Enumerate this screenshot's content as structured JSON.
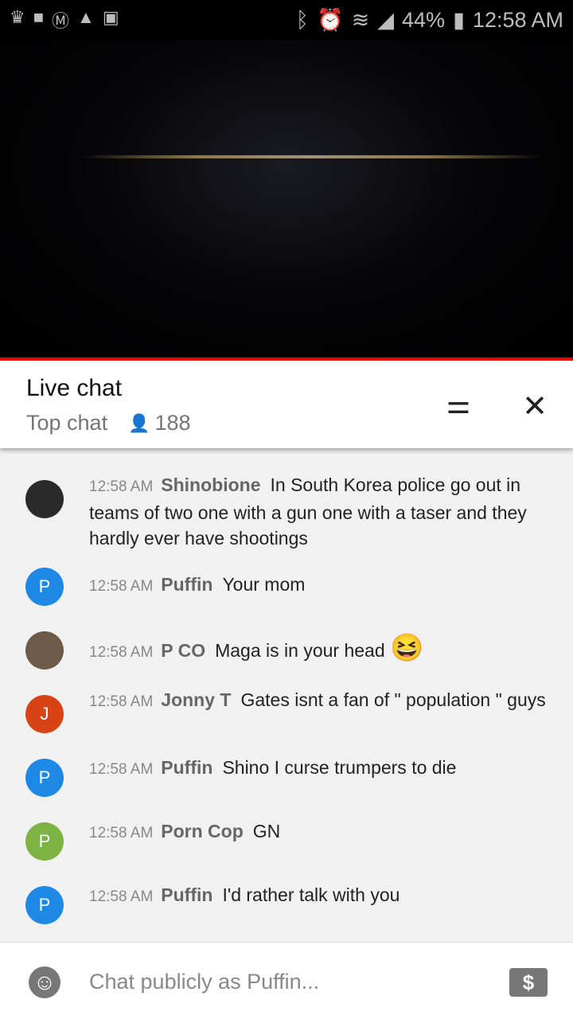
{
  "status_bar": {
    "battery": "44%",
    "time": "12:58 AM"
  },
  "chat_header": {
    "title": "Live chat",
    "mode": "Top chat",
    "viewers": "188"
  },
  "messages": [
    {
      "time": "12:58 AM",
      "author": "Shinobione",
      "text": "In South Korea police go out in teams of two one with a gun one with a taser and they hardly ever have shootings",
      "avatar": "",
      "color": "#2a2a2a"
    },
    {
      "time": "12:58 AM",
      "author": "Puffin",
      "text": "Your mom",
      "avatar": "P",
      "color": "#1e88e5"
    },
    {
      "time": "12:58 AM",
      "author": "P CO",
      "text": "Maga is in your head",
      "emoji": "😆",
      "avatar": "",
      "color": "#6d5a48"
    },
    {
      "time": "12:58 AM",
      "author": "Jonny T",
      "text": "Gates isnt a fan of \" population \" guys",
      "avatar": "J",
      "color": "#d84315"
    },
    {
      "time": "12:58 AM",
      "author": "Puffin",
      "text": "Shino I curse trumpers to die",
      "avatar": "P",
      "color": "#1e88e5"
    },
    {
      "time": "12:58 AM",
      "author": "Porn Cop",
      "text": "GN",
      "avatar": "P",
      "color": "#7cb342"
    },
    {
      "time": "12:58 AM",
      "author": "Puffin",
      "text": "I'd rather talk with you",
      "avatar": "P",
      "color": "#1e88e5"
    }
  ],
  "input": {
    "placeholder": "Chat publicly as Puffin..."
  }
}
